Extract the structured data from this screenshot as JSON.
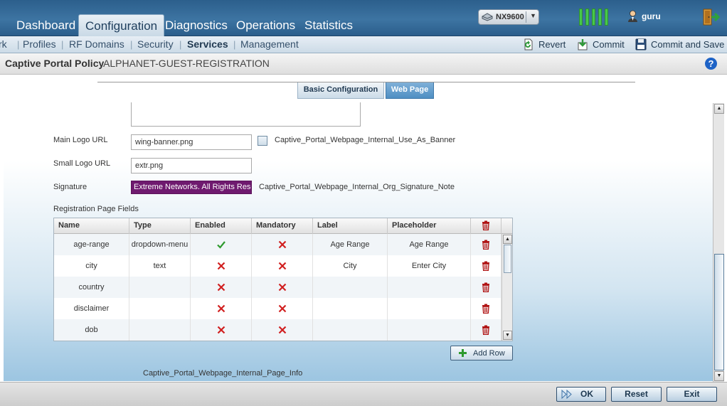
{
  "topnav": {
    "tabs": [
      {
        "label": "Dashboard"
      },
      {
        "label": "Configuration"
      },
      {
        "label": "Diagnostics"
      },
      {
        "label": "Operations"
      },
      {
        "label": "Statistics"
      }
    ],
    "active_tab": "Configuration",
    "device": "NX9600",
    "user": "guru"
  },
  "subnav": {
    "items": [
      "rk",
      "Profiles",
      "RF Domains",
      "Security",
      "Services",
      "Management"
    ],
    "active": "Services",
    "actions": {
      "revert": "Revert",
      "commit": "Commit",
      "commit_save": "Commit and Save"
    }
  },
  "title": {
    "label": "Captive Portal Policy",
    "value": "ALPHANET-GUEST-REGISTRATION",
    "help": "?"
  },
  "tabs": {
    "basic": "Basic Configuration",
    "web": "Web Page"
  },
  "form": {
    "main_logo_label": "Main Logo URL",
    "main_logo_value": "wing-banner.png",
    "banner_checkbox_label": "Captive_Portal_Webpage_Internal_Use_As_Banner",
    "small_logo_label": "Small Logo URL",
    "small_logo_value": "extr.png",
    "signature_label": "Signature",
    "signature_value": "Extreme Networks. All Rights Reserved",
    "signature_note": "Captive_Portal_Webpage_Internal_Org_Signature_Note",
    "reg_fields_label": "Registration Page Fields"
  },
  "grid": {
    "headers": [
      "Name",
      "Type",
      "Enabled",
      "Mandatory",
      "Label",
      "Placeholder"
    ],
    "rows": [
      {
        "name": "age-range",
        "type": "dropdown-menu",
        "enabled": true,
        "mandatory": false,
        "label": "Age Range",
        "placeholder": "Age Range"
      },
      {
        "name": "city",
        "type": "text",
        "enabled": false,
        "mandatory": false,
        "label": "City",
        "placeholder": "Enter City"
      },
      {
        "name": "country",
        "type": "",
        "enabled": false,
        "mandatory": false,
        "label": "",
        "placeholder": ""
      },
      {
        "name": "disclaimer",
        "type": "",
        "enabled": false,
        "mandatory": false,
        "label": "",
        "placeholder": ""
      },
      {
        "name": "dob",
        "type": "",
        "enabled": false,
        "mandatory": false,
        "label": "",
        "placeholder": ""
      }
    ],
    "add_row": "Add Row"
  },
  "page_info": "Captive_Portal_Webpage_Internal_Page_Info",
  "footer": {
    "ok": "OK",
    "reset": "Reset",
    "exit": "Exit"
  },
  "colors": {
    "nav_blue": "#3d74a2",
    "signature_bg": "#6f1a6f",
    "check_green": "#2e9a2e",
    "cross_red": "#d11f1f",
    "trash_red": "#b01414"
  },
  "icons": [
    "device-icon",
    "signal-icon",
    "user-icon",
    "logout-icon",
    "revert-icon",
    "commit-icon",
    "save-icon",
    "help-icon",
    "trash-icon",
    "check-icon",
    "cross-icon",
    "plus-icon",
    "ok-icon"
  ]
}
